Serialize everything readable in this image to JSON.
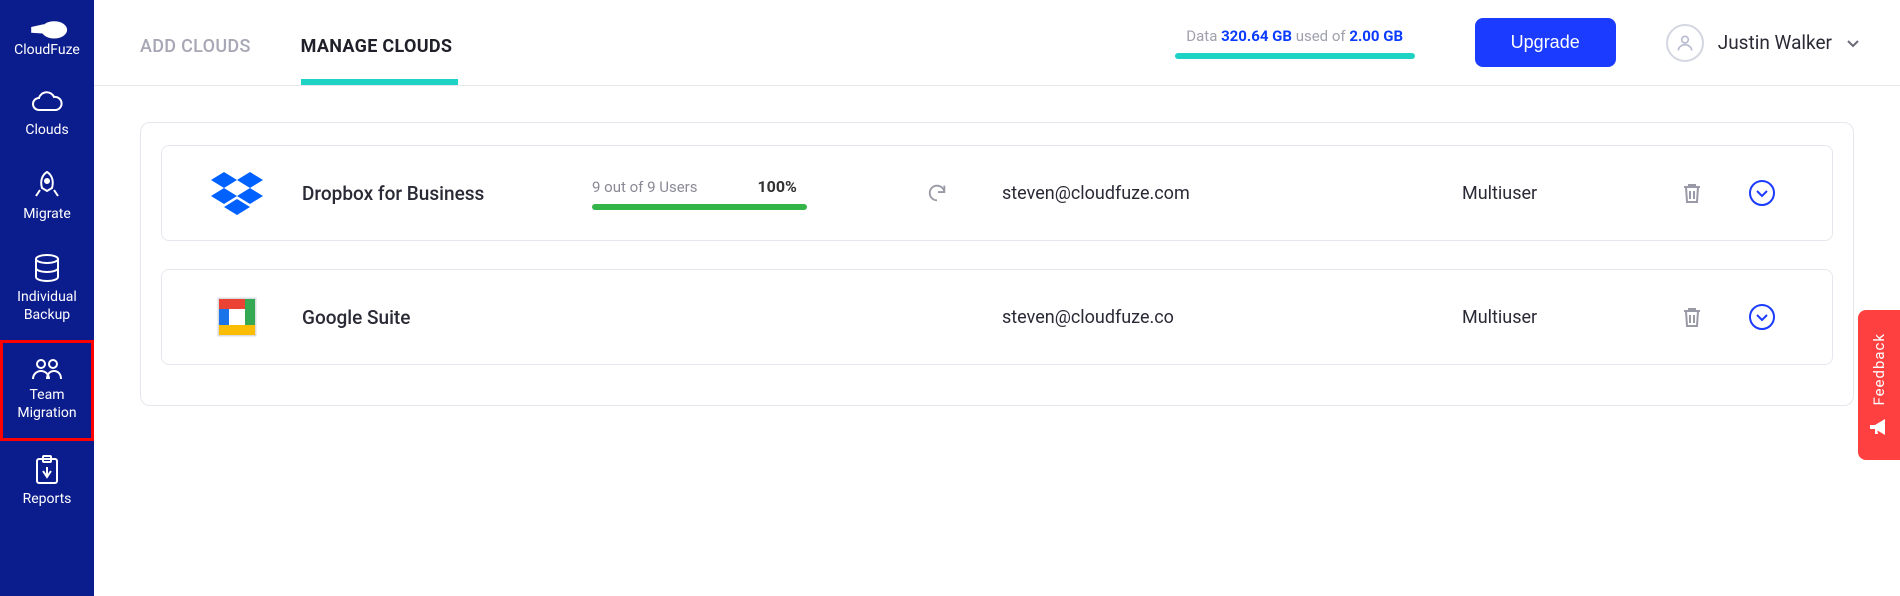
{
  "brand": {
    "name": "CloudFuze"
  },
  "sidebar": {
    "items": [
      {
        "label": "Clouds",
        "icon": "cloud-icon"
      },
      {
        "label": "Migrate",
        "icon": "rocket-icon"
      },
      {
        "label": "Individual Backup",
        "icon": "database-icon"
      },
      {
        "label": "Team Migration",
        "icon": "team-icon"
      },
      {
        "label": "Reports",
        "icon": "report-icon"
      }
    ]
  },
  "tabs": {
    "add": "ADD CLOUDS",
    "manage": "MANAGE CLOUDS"
  },
  "usage": {
    "prefix": "Data ",
    "used": "320.64 GB",
    "middle": " used of ",
    "total": "2.00 GB"
  },
  "upgrade_label": "Upgrade",
  "user": {
    "name": "Justin Walker"
  },
  "clouds": [
    {
      "name": "Dropbox for Business",
      "users_text": "9 out of 9 Users",
      "pct": "100%",
      "email": "steven@cloudfuze.com",
      "type": "Multiuser"
    },
    {
      "name": "Google Suite",
      "users_text": "",
      "pct": "",
      "email": "steven@cloudfuze.co",
      "type": "Multiuser"
    }
  ],
  "feedback_label": "Feedback"
}
